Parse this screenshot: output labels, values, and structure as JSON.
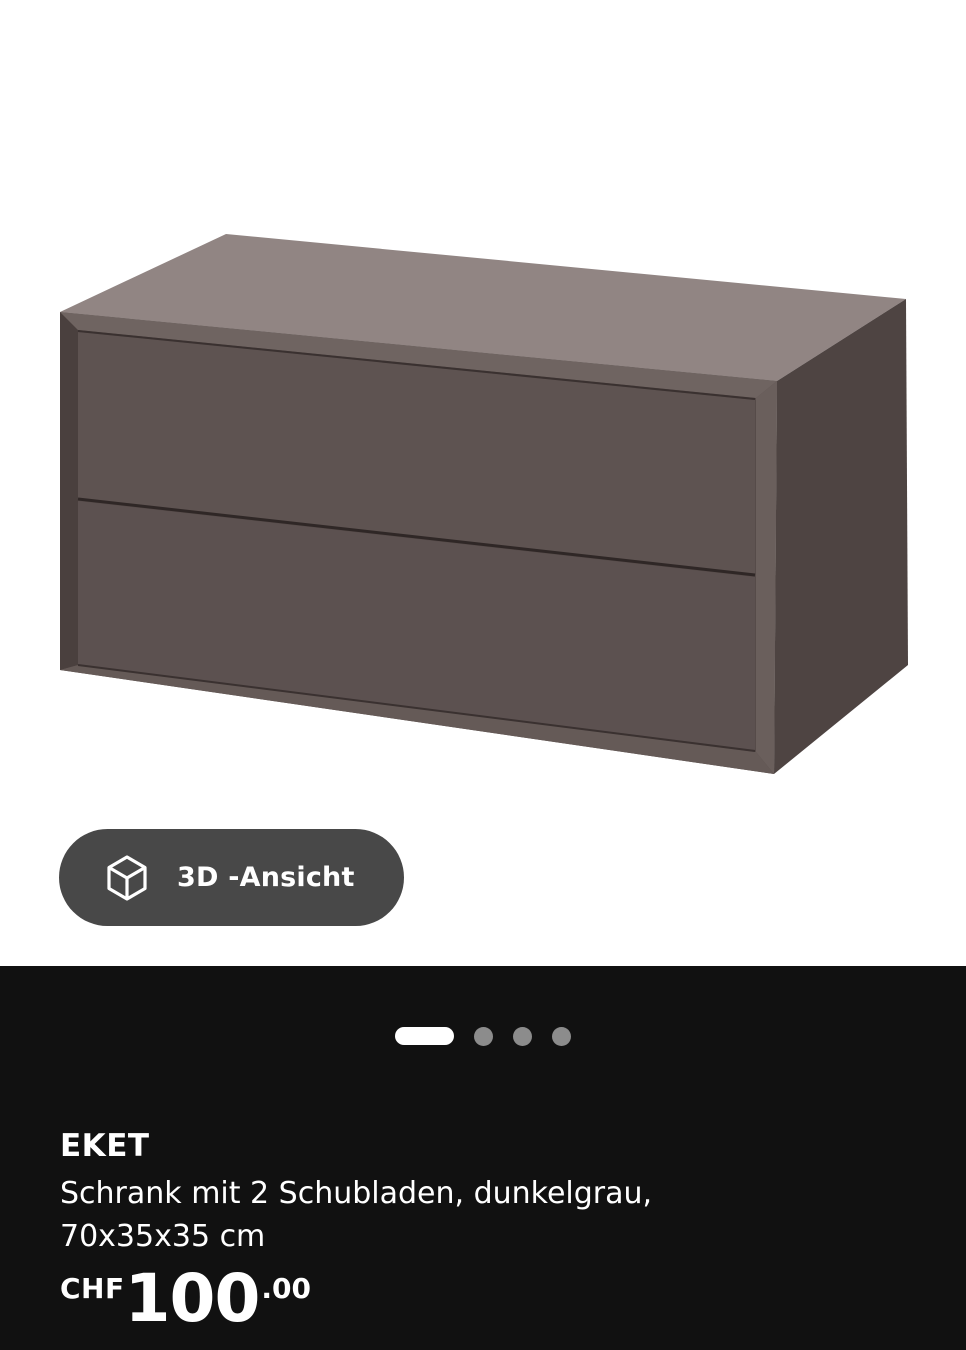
{
  "product_image": {
    "subject": "dark grey cabinet with two drawers"
  },
  "view_3d_button": {
    "label": "3D -Ansicht",
    "icon": "cube-3d-icon"
  },
  "carousel": {
    "total": 4,
    "active_index": 0
  },
  "product": {
    "name": "EKET",
    "description": "Schrank mit 2 Schubladen, dunkelgrau, 70x35x35 cm",
    "price": {
      "currency": "CHF",
      "integer": "100",
      "decimals": ".00"
    }
  },
  "colors": {
    "info_background": "#111111",
    "button_background": "#484848",
    "text": "#ffffff",
    "cabinet_top": "#918583",
    "cabinet_front": "#5a4f4d",
    "cabinet_edge": "#3e3533"
  }
}
